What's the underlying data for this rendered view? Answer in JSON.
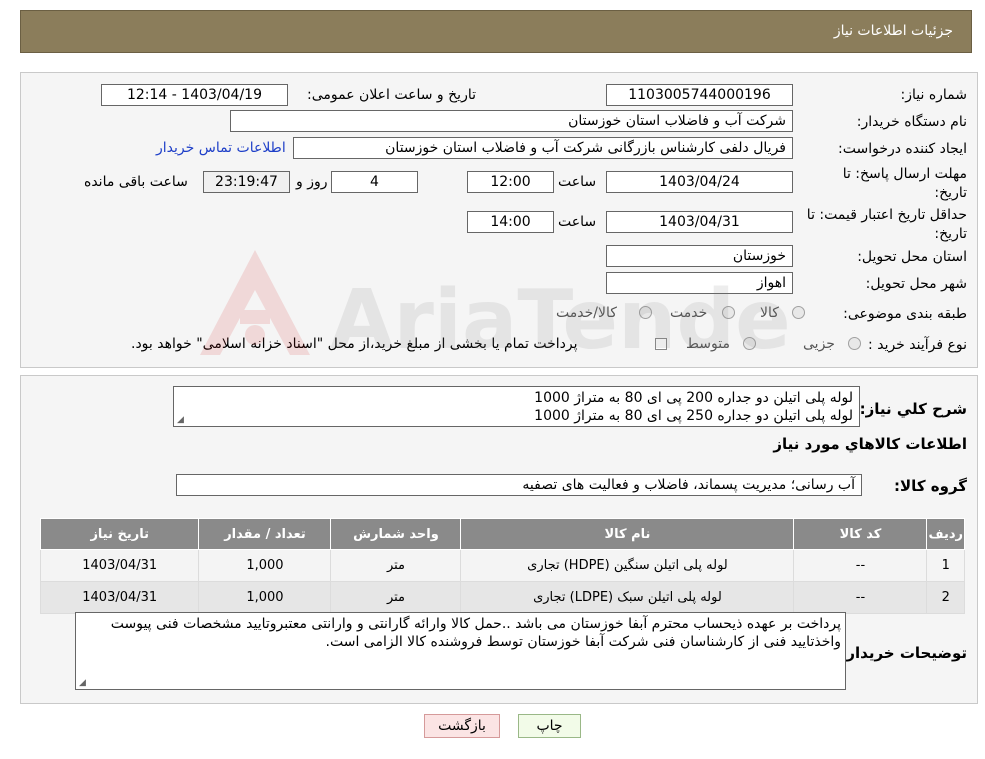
{
  "header": {
    "title": "جزئیات اطلاعات نیاز"
  },
  "form": {
    "need_number_label": "شماره نیاز:",
    "need_number": "1103005744000196",
    "announce_label": "تاریخ و ساعت اعلان عمومی:",
    "announce_value": "1403/04/19 - 12:14",
    "buyer_org_label": "نام دستگاه خریدار:",
    "buyer_org": "شرکت آب و فاضلاب استان خوزستان",
    "requester_label": "ایجاد کننده درخواست:",
    "requester": "فریال دلفی کارشناس بازرگانی شرکت آب و فاضلاب استان خوزستان",
    "contact_link": "اطلاعات تماس خریدار",
    "deadline_label": "مهلت ارسال پاسخ: تا تاریخ:",
    "deadline_date": "1403/04/24",
    "time_label": "ساعت",
    "deadline_time": "12:00",
    "days_value": "4",
    "days_label": "روز و",
    "remaining_time": "23:19:47",
    "remaining_label": "ساعت باقی مانده",
    "validity_label": "حداقل تاریخ اعتبار قیمت: تا تاریخ:",
    "validity_date": "1403/04/31",
    "validity_time": "14:00",
    "province_label": "استان محل تحویل:",
    "province": "خوزستان",
    "city_label": "شهر محل تحویل:",
    "city": "اهواز",
    "category_label": "طبقه بندی موضوعی:",
    "category_options": [
      "کالا",
      "خدمت",
      "کالا/خدمت"
    ],
    "process_label": "نوع فرآیند خرید :",
    "process_options": [
      "جزیی",
      "متوسط"
    ],
    "payment_note": "پرداخت تمام یا بخشی از مبلغ خرید،از محل \"اسناد خزانه اسلامی\" خواهد بود."
  },
  "details": {
    "summary_label": "شرح کلي نياز:",
    "summary_lines": [
      "لوله پلی اتیلن دو جداره 200 پی ای 80 به متراژ 1000",
      "لوله پلی اتیلن دو جداره 250 پی ای 80 به متراژ 1000"
    ],
    "goods_info_title": "اطلاعات کالاهاي مورد نياز",
    "goods_group_label": "گروه کالا:",
    "goods_group": "آب رسانی؛ مدیریت پسماند، فاضلاب و فعالیت های تصفیه",
    "table": {
      "headers": [
        "رديف",
        "کد کالا",
        "نام کالا",
        "واحد شمارش",
        "تعداد / مقدار",
        "تاریخ نیاز"
      ],
      "rows": [
        [
          "1",
          "--",
          "لوله پلی اتیلن سنگین (HDPE) تجاری",
          "متر",
          "1,000",
          "1403/04/31"
        ],
        [
          "2",
          "--",
          "لوله پلی اتیلن سبک (LDPE) تجاری",
          "متر",
          "1,000",
          "1403/04/31"
        ]
      ]
    },
    "buyer_notes_label": "توضیحات خریدار:",
    "buyer_notes": "پرداخت بر عهده ذیحساب محترم آبفا خوزستان می باشد ..حمل کالا وارائه گارانتی و وارانتی معتبروتایید مشخصات فنی پیوست واخذتایید فنی از کارشناسان فنی شرکت آبفا خوزستان توسط فروشنده کالا الزامی است."
  },
  "buttons": {
    "print": "چاپ",
    "back": "بازگشت"
  },
  "watermark": {
    "brand": "AriaTender.neT"
  },
  "colors": {
    "header": "#8b7d5b",
    "link": "#1e3fc8",
    "table_header": "#8a8a8a",
    "back_button": "#fbe4e4"
  }
}
